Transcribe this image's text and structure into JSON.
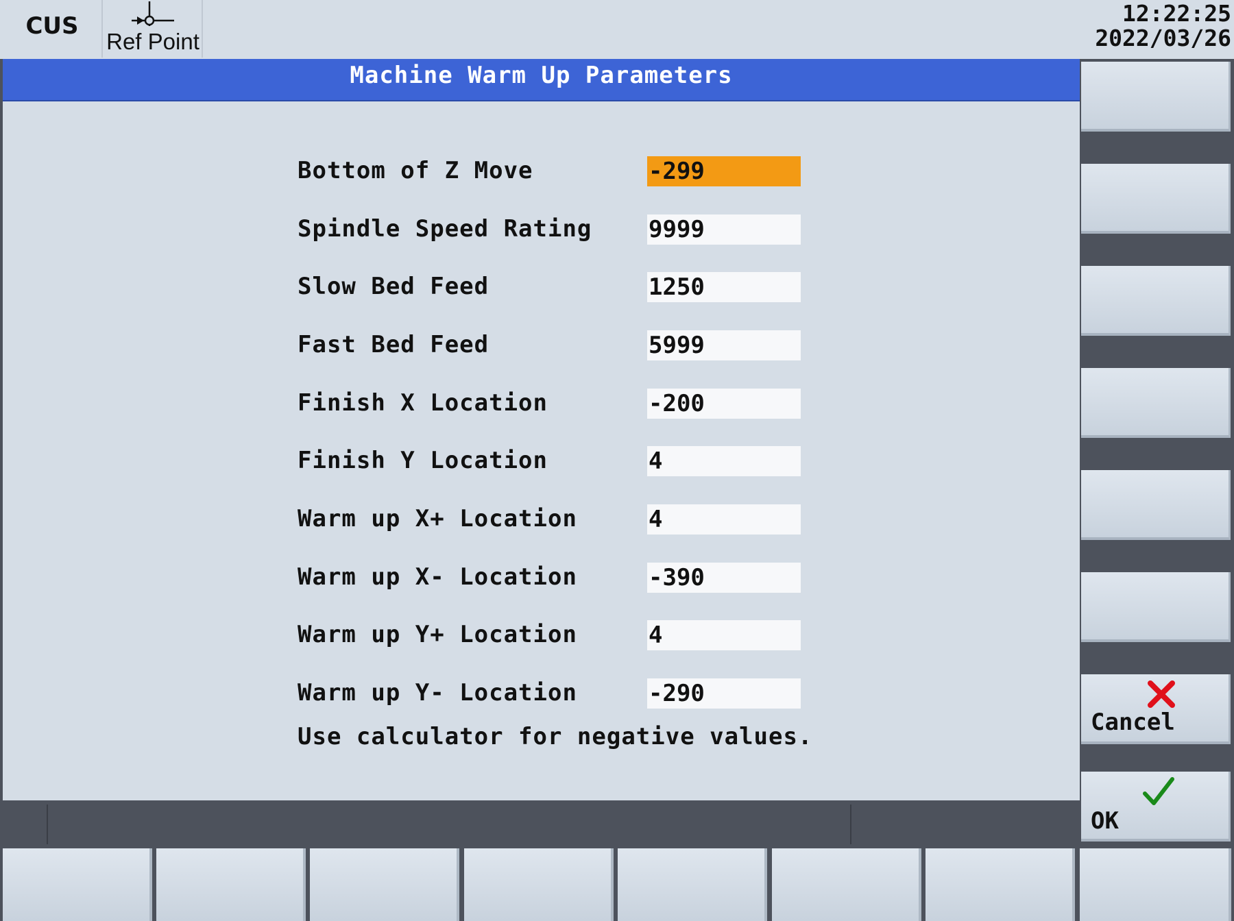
{
  "header": {
    "mode": "CUS",
    "refpoint_label": "Ref Point",
    "time": "12:22:25",
    "date": "2022/03/26"
  },
  "dialog": {
    "title": "Machine Warm Up Parameters",
    "fields": [
      {
        "label": "Bottom of Z Move",
        "value": "-299"
      },
      {
        "label": "Spindle Speed Rating",
        "value": "9999"
      },
      {
        "label": "Slow Bed Feed",
        "value": "1250"
      },
      {
        "label": "Fast Bed Feed",
        "value": "5999"
      },
      {
        "label": "Finish X Location",
        "value": "-200"
      },
      {
        "label": "Finish Y Location",
        "value": "4"
      },
      {
        "label": "Warm up X+ Location",
        "value": "4"
      },
      {
        "label": "Warm up X- Location",
        "value": "-390"
      },
      {
        "label": "Warm up Y+ Location",
        "value": "4"
      },
      {
        "label": "Warm up Y- Location",
        "value": "-290"
      }
    ],
    "hint": "Use calculator for negative values."
  },
  "softkeys": {
    "cancel_label": "Cancel",
    "ok_label": "OK"
  },
  "colors": {
    "title_bar": "#3d64d6",
    "active_field": "#f39a14",
    "cancel_icon": "#e0101a",
    "ok_icon": "#1a8a1a"
  },
  "icons": {
    "refpoint": "ref-point-icon",
    "cancel": "cancel-x-icon",
    "ok": "ok-check-icon"
  }
}
